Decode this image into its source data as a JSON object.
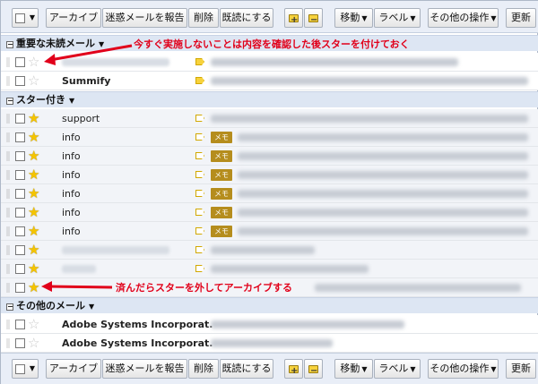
{
  "toolbar": {
    "archive": "アーカイブ",
    "spam": "迷惑メールを報告",
    "delete": "削除",
    "mark_read": "既読にする",
    "move": "移動",
    "labels": "ラベル",
    "more": "その他の操作",
    "refresh": "更新"
  },
  "sections": {
    "important_unread": "重要な未読メール",
    "starred": "スター付き",
    "other": "その他のメール"
  },
  "annotations": {
    "top_note": "今すぐ実施しないことは内容を確認した後スターを付けておく",
    "bottom_note": "済んだらスターを外してアーカイブする"
  },
  "rows": {
    "r2": {
      "sender": "Summify"
    },
    "r3": {
      "sender": "support"
    },
    "r4": {
      "sender": "info",
      "label": "メモ"
    },
    "r5": {
      "sender": "info",
      "label": "メモ"
    },
    "r6": {
      "sender": "info",
      "label": "メモ"
    },
    "r7": {
      "sender": "info",
      "label": "メモ"
    },
    "r8": {
      "sender": "info",
      "label": "メモ"
    },
    "r9": {
      "sender": "info",
      "label": "メモ"
    },
    "r13": {
      "sender": "Adobe Systems Incorporat."
    },
    "r14": {
      "sender": "Adobe Systems Incorporat."
    }
  },
  "colors": {
    "annotation": "#e1001a",
    "star": "#f5c400",
    "memo_label": "#b58d1d"
  }
}
